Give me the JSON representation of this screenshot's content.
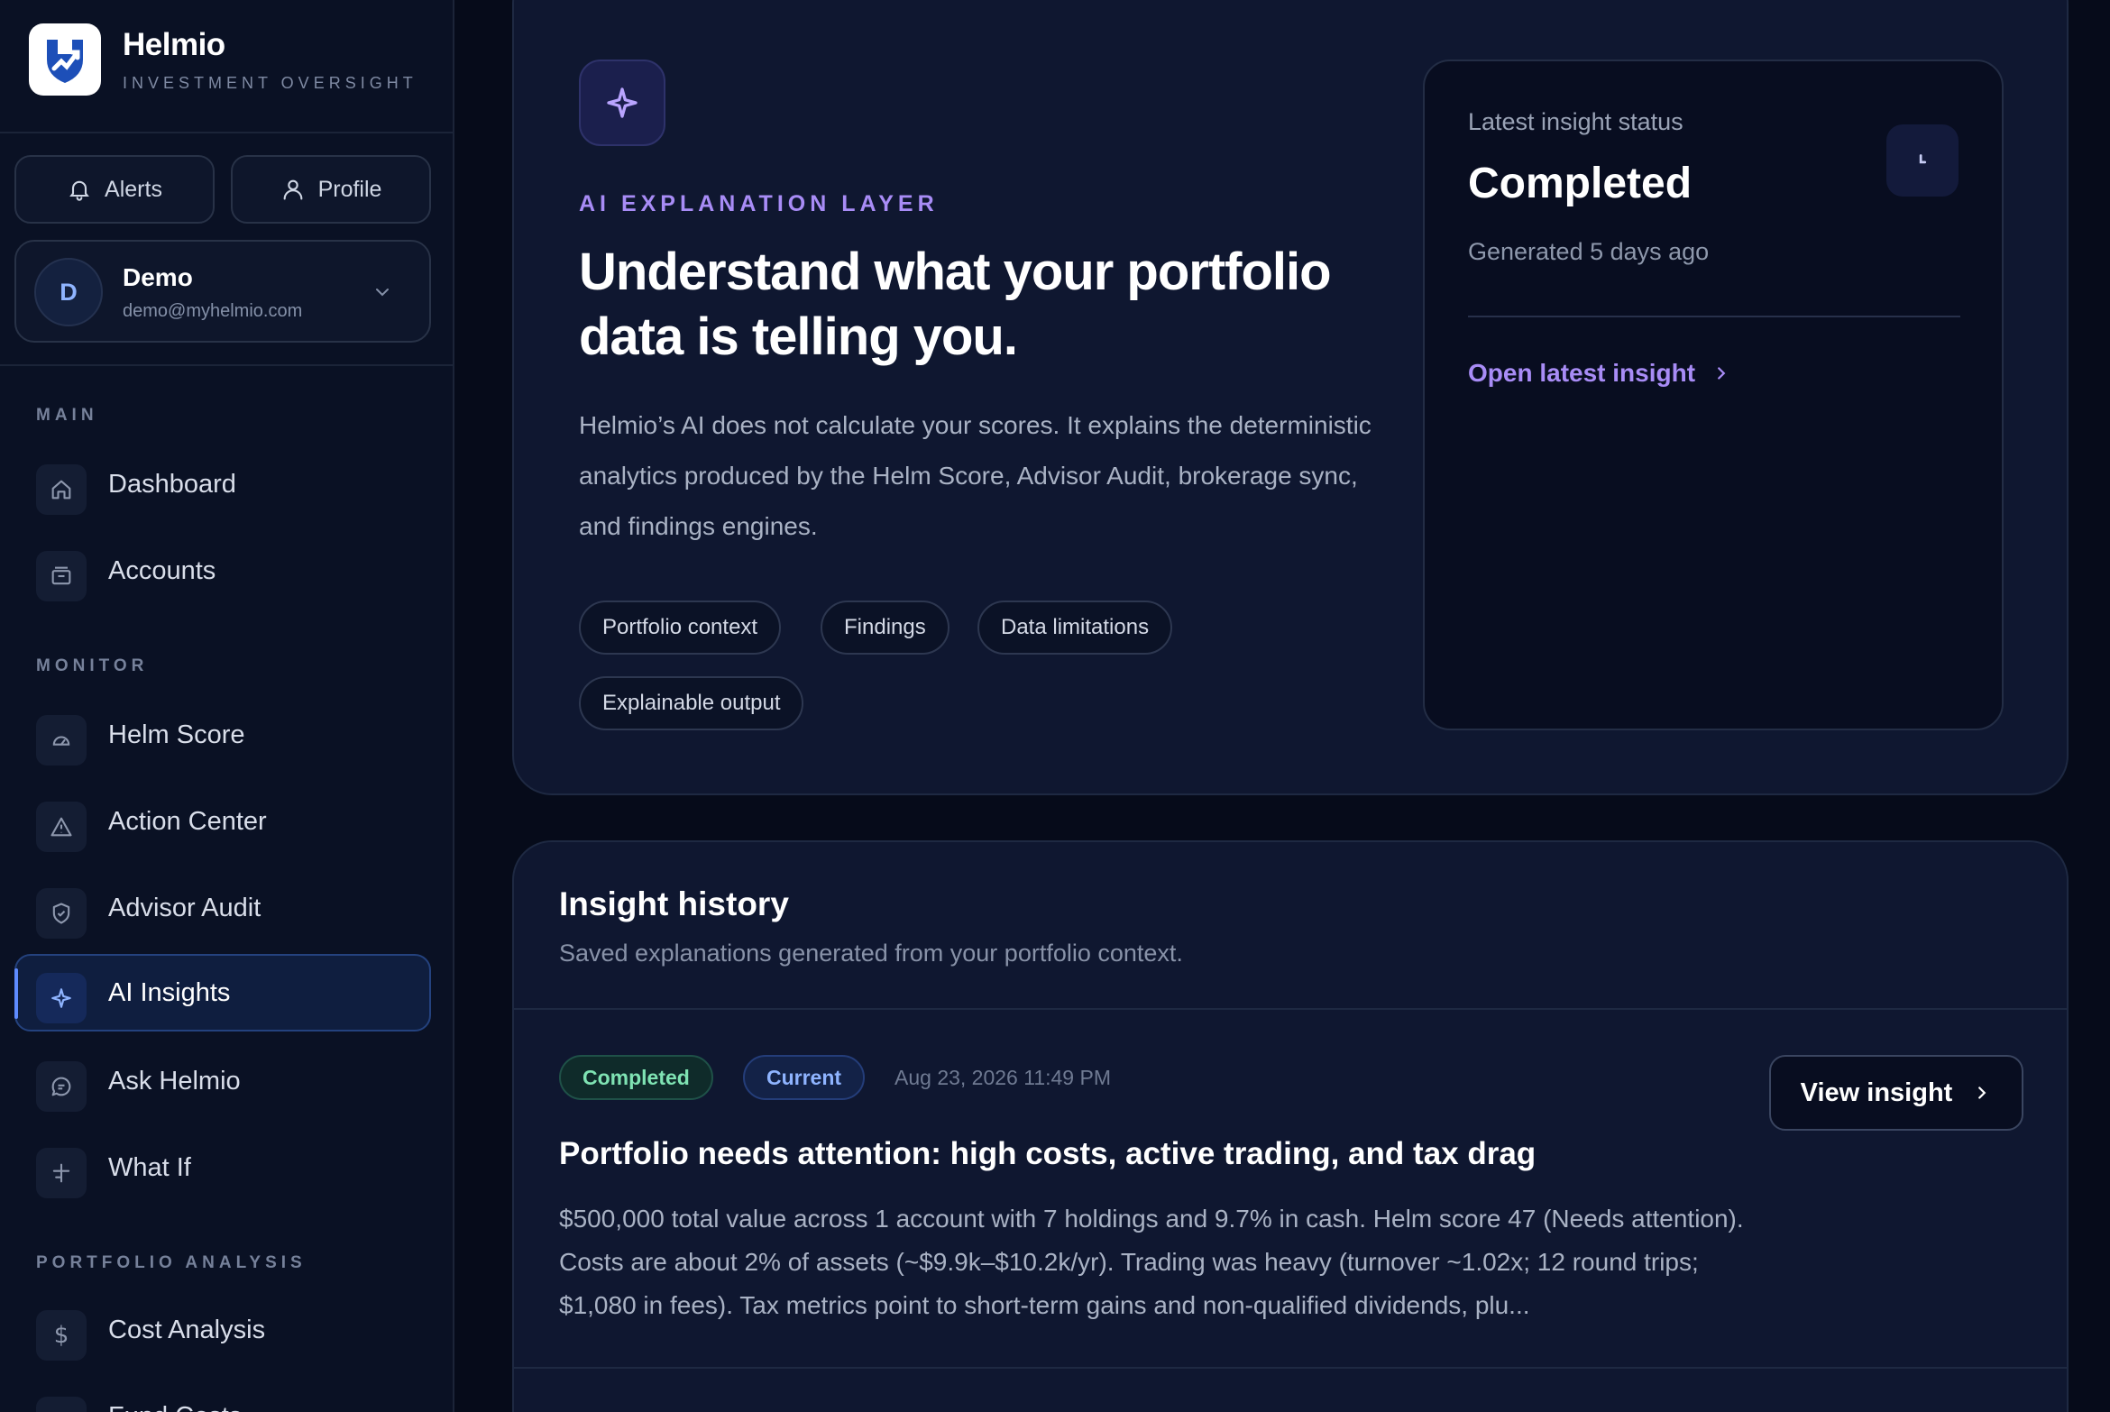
{
  "brand": {
    "name": "Helmio",
    "tagline": "INVESTMENT OVERSIGHT"
  },
  "header_buttons": {
    "alerts": "Alerts",
    "profile": "Profile"
  },
  "user": {
    "initial": "D",
    "name": "Demo",
    "email": "demo@myhelmio.com"
  },
  "sidebar": {
    "sections": [
      {
        "label": "MAIN",
        "items": [
          {
            "label": "Dashboard",
            "icon": "home-icon"
          },
          {
            "label": "Accounts",
            "icon": "wallet-icon"
          }
        ]
      },
      {
        "label": "MONITOR",
        "items": [
          {
            "label": "Helm Score",
            "icon": "gauge-icon"
          },
          {
            "label": "Action Center",
            "icon": "warning-icon"
          },
          {
            "label": "Advisor Audit",
            "icon": "shield-icon"
          },
          {
            "label": "AI Insights",
            "icon": "sparkle-icon",
            "active": true
          },
          {
            "label": "Ask Helmio",
            "icon": "chat-icon"
          },
          {
            "label": "What If",
            "icon": "plus-minus-icon"
          }
        ]
      },
      {
        "label": "PORTFOLIO ANALYSIS",
        "items": [
          {
            "label": "Cost Analysis",
            "icon": "dollar-icon"
          },
          {
            "label": "Fund Costs",
            "icon": "document-icon"
          }
        ]
      }
    ]
  },
  "hero": {
    "eyebrow": "AI EXPLANATION LAYER",
    "title": "Understand what your portfolio data is telling you.",
    "description": "Helmio’s AI does not calculate your scores. It explains the deterministic analytics produced by the Helm Score, Advisor Audit, brokerage sync, and findings engines.",
    "chips": [
      "Portfolio context",
      "Findings",
      "Data limitations",
      "Explainable output"
    ]
  },
  "status": {
    "label": "Latest insight status",
    "value": "Completed",
    "generated": "Generated 5 days ago",
    "link": "Open latest insight"
  },
  "history": {
    "title": "Insight history",
    "subtitle": "Saved explanations generated from your portfolio context.",
    "items": [
      {
        "status": "Completed",
        "tag": "Current",
        "timestamp": "Aug 23, 2026 11:49 PM",
        "action": "View insight",
        "title": "Portfolio needs attention: high costs, active trading, and tax drag",
        "summary": "$500,000 total value across 1 account with 7 holdings and 9.7% in cash. Helm score 47 (Needs attention). Costs are about 2% of assets (~$9.9k–$10.2k/yr). Trading was heavy (turnover ~1.02x; 12 round trips; $1,080 in fees). Tax metrics point to short-term gains and non-qualified dividends, plu..."
      }
    ]
  },
  "colors": {
    "accent": "#a88cf6",
    "primary": "#5e8bff",
    "success": "#7fe3b3",
    "background": "#060b1a"
  }
}
